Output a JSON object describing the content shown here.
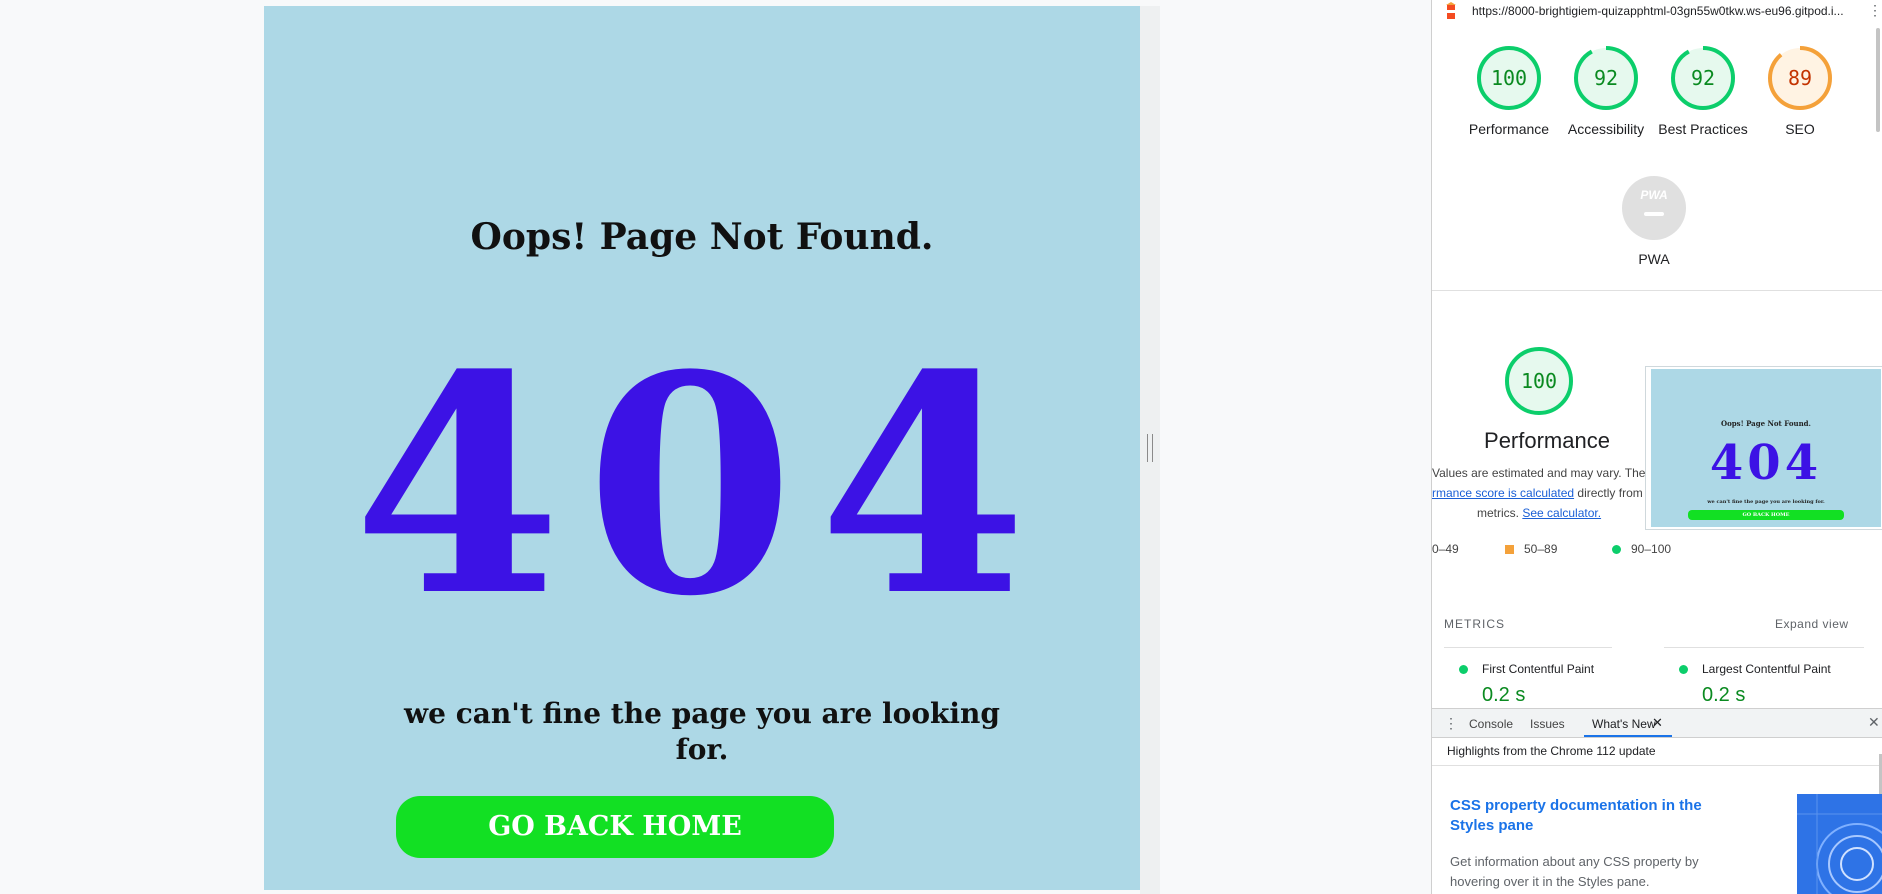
{
  "page": {
    "title": "Oops! Page Not Found.",
    "code": "404",
    "message": "we can't fine the page you are looking for.",
    "button_label": "GO BACK HOME",
    "bg_color": "#add8e6",
    "code_color": "#3c12e5",
    "button_color": "#12e023"
  },
  "devtools": {
    "url": "https://8000-brightigiem-quizapphtml-03gn55w0tkw.ws-eu96.gitpod.i...",
    "scores": [
      {
        "label": "Performance",
        "value": "100",
        "fraction": 1.0,
        "color": "#0cce6b",
        "text_color": "#0a8a20",
        "fill": "#e6f9ee"
      },
      {
        "label": "Accessibility",
        "value": "92",
        "fraction": 0.92,
        "color": "#0cce6b",
        "text_color": "#0a8a20",
        "fill": "#e6f9ee"
      },
      {
        "label": "Best Practices",
        "value": "92",
        "fraction": 0.92,
        "color": "#0cce6b",
        "text_color": "#0a8a20",
        "fill": "#e6f9ee"
      },
      {
        "label": "SEO",
        "value": "89",
        "fraction": 0.89,
        "color": "#f4a13a",
        "text_color": "#c33300",
        "fill": "#fff3e3"
      }
    ],
    "pwa": {
      "badge": "PWA",
      "label": "PWA"
    },
    "performance": {
      "score": "100",
      "fraction": 1.0,
      "title": "Performance",
      "note_line1": "Values are estimated and may vary. The",
      "note_link1": "rmance score is calculated",
      "note_line2_rest": "directly from t",
      "note_line3": "metrics.",
      "note_link2": "See calculator."
    },
    "thumbnail": {
      "title": "Oops! Page Not Found.",
      "code": "404",
      "message": "we can't fine the page you are looking for.",
      "button": "GO BACK HOME"
    },
    "legend": [
      {
        "label": "0–49"
      },
      {
        "label": "50–89"
      },
      {
        "label": "90–100"
      }
    ],
    "metrics": {
      "header": "METRICS",
      "expand": "Expand view",
      "items": [
        {
          "label": "First Contentful Paint",
          "value": "0.2 s"
        },
        {
          "label": "Largest Contentful Paint",
          "value": "0.2 s"
        }
      ]
    },
    "drawer": {
      "tabs": [
        "Console",
        "Issues",
        "What's New"
      ],
      "active_tab": "What's New",
      "highlights": "Highlights from the Chrome 112 update",
      "feature_title": "CSS property documentation in the Styles pane",
      "feature_desc": "Get information about any CSS property by hovering over it in the Styles pane."
    }
  }
}
